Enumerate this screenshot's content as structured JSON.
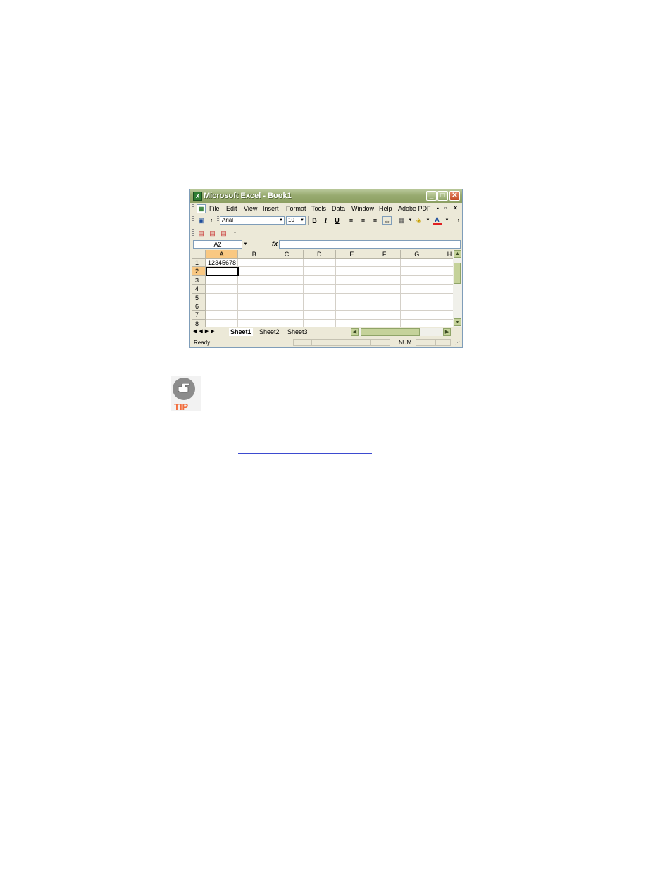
{
  "window": {
    "title": "Microsoft Excel - Book1",
    "minimize": "_",
    "maximize": "□",
    "close": "✕"
  },
  "menu": {
    "items": [
      "File",
      "Edit",
      "View",
      "Insert",
      "Format",
      "Tools",
      "Data",
      "Window",
      "Help",
      "Adobe PDF"
    ],
    "doc_minimize": "-",
    "doc_restore": "ð",
    "doc_close": "×"
  },
  "formatting": {
    "font": "Arial",
    "size": "10",
    "bold": "B",
    "italic": "I",
    "underline": "U",
    "font_color": "A"
  },
  "formula_bar": {
    "name_box": "A2",
    "fx": "fx",
    "formula": ""
  },
  "grid": {
    "columns": [
      "A",
      "B",
      "C",
      "D",
      "E",
      "F",
      "G",
      "H"
    ],
    "rows": [
      "1",
      "2",
      "3",
      "4",
      "5",
      "6",
      "7",
      "8"
    ],
    "cell_a1": "12345678",
    "selected_column": "A",
    "selected_row": "2"
  },
  "sheets": [
    "Sheet1",
    "Sheet2",
    "Sheet3"
  ],
  "status": {
    "text": "Ready",
    "num": "NUM"
  },
  "tip": {
    "label": "TIP"
  },
  "colors": {
    "title_green": "#97aa6f",
    "selected_header": "#f9c882",
    "tip_orange": "#f26c3b",
    "link_blue": "#3d4bd0"
  }
}
